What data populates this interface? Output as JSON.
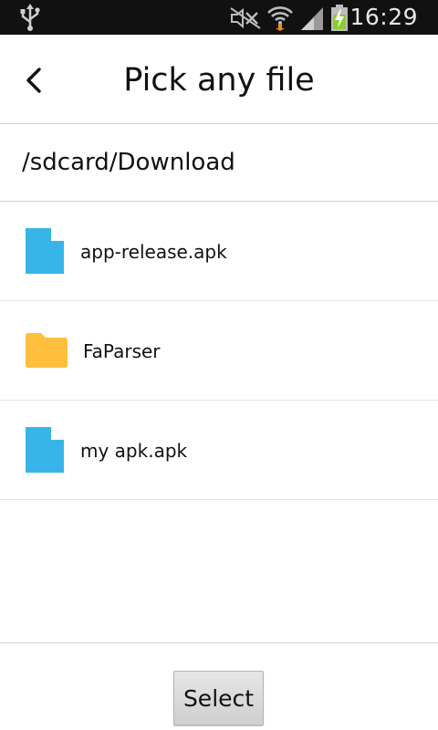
{
  "status_bar": {
    "time": "16:29",
    "icons": [
      "usb-icon",
      "mute-icon",
      "wifi-icon",
      "signal-icon",
      "battery-charging-icon"
    ]
  },
  "header": {
    "title": "Pick any file",
    "back_icon": "back-arrow-icon"
  },
  "path": "/sdcard/Download",
  "files": [
    {
      "name": "app-release.apk",
      "type": "file",
      "icon": "file-icon"
    },
    {
      "name": "FaParser",
      "type": "folder",
      "icon": "folder-icon"
    },
    {
      "name": "my apk.apk",
      "type": "file",
      "icon": "file-icon"
    }
  ],
  "footer": {
    "select_label": "Select"
  },
  "colors": {
    "file_icon": "#37B5E9",
    "folder_icon": "#FFBE3C",
    "status_bar": "#111111",
    "battery": "#8ACD2C",
    "download_arrow": "#F08C1E"
  }
}
